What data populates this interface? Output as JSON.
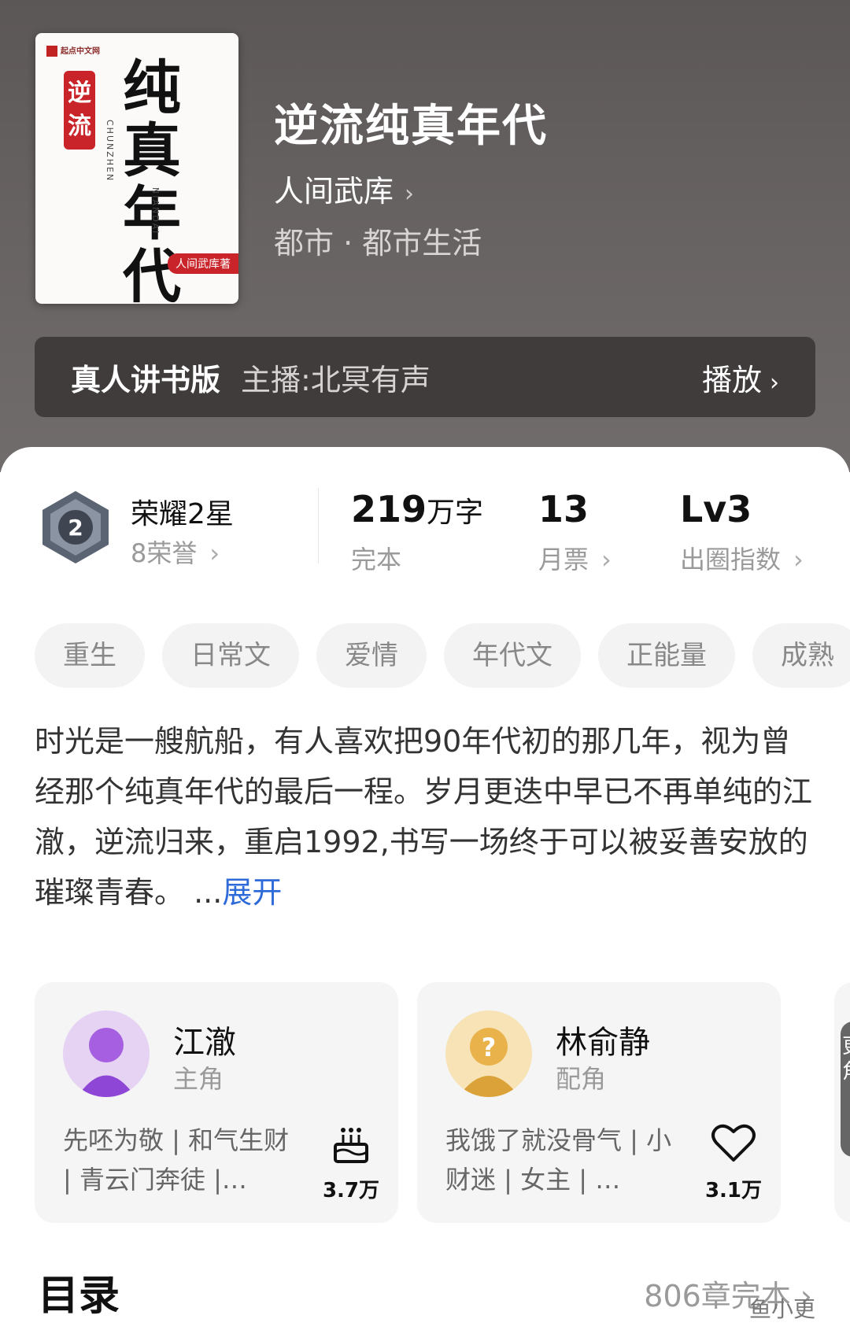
{
  "book": {
    "title": "逆流纯真年代",
    "author": "人间武库",
    "genre": "都市 · 都市生活",
    "cover": {
      "publisher": "起点中文网",
      "sub": "逆流",
      "main": "纯真年代",
      "pinyin1": "CHUNZHEN",
      "pinyin2": "NIANDAI",
      "stamp": "人间武库著"
    }
  },
  "audio": {
    "label": "真人讲书版",
    "narrator": "主播:北冥有声",
    "play": "播放"
  },
  "stats": {
    "honor_title": "荣耀2星",
    "honor_count": "8荣誉",
    "words_value": "219",
    "words_unit": "万字",
    "words_label": "完本",
    "ticket_value": "13",
    "ticket_label": "月票",
    "level_value": "Lv3",
    "level_label": "出圈指数"
  },
  "tags": [
    "重生",
    "日常文",
    "爱情",
    "年代文",
    "正能量",
    "成熟"
  ],
  "description": {
    "text": "时光是一艘航船，有人喜欢把90年代初的那几年，视为曾经那个纯真年代的最后一程。岁月更迭中早已不再单纯的江澈，逆流归来，重启1992,书写一场终于可以被妥善安放的璀璨青春。 ...",
    "expand": "展开"
  },
  "roles": [
    {
      "name": "江澈",
      "type": "主角",
      "tags": "先呸为敬 | 和气生财 | 青云门奔徒 |…",
      "count": "3.7万",
      "icon": "cake-icon"
    },
    {
      "name": "林俞静",
      "type": "配角",
      "tags": "我饿了就没骨气 | 小财迷 | 女主 | …",
      "count": "3.1万",
      "icon": "heart-icon"
    }
  ],
  "more_roles": "更多角色",
  "toc": {
    "title": "目录",
    "info": "806章完本"
  },
  "watermark": "鱼小更",
  "colors": {
    "link": "#2e6bd9",
    "hero_bg": "#5c5757",
    "card_bg": "#f5f5f5"
  }
}
